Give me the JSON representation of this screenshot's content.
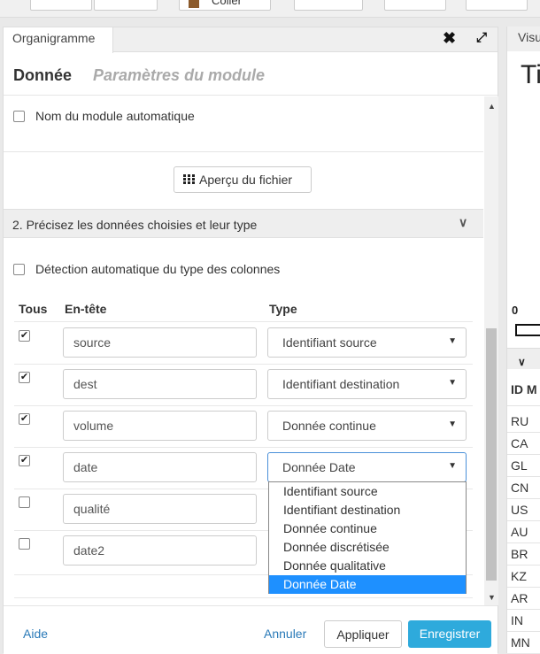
{
  "toolbar": {
    "paste_label": "Coller"
  },
  "panel": {
    "tab_label": "Organigramme",
    "close_glyph": "✖",
    "expand_glyph": "⤢",
    "header": {
      "title": "Donnée",
      "subtitle": "Paramètres du module"
    }
  },
  "form": {
    "auto_name_label": "Nom du module automatique",
    "apercu_label": "Aperçu du fichier",
    "section_title": "2. Précisez les données choisies et leur type",
    "auto_detect_label": "Détection automatique du type des colonnes",
    "columns": {
      "all": "Tous",
      "header": "En-tête",
      "type": "Type"
    },
    "rows": [
      {
        "checked": true,
        "header": "source",
        "type": "Identifiant source"
      },
      {
        "checked": true,
        "header": "dest",
        "type": "Identifiant destination"
      },
      {
        "checked": true,
        "header": "volume",
        "type": "Donnée continue"
      },
      {
        "checked": true,
        "header": "date",
        "type": "Donnée Date"
      },
      {
        "checked": false,
        "header": "qualité",
        "type": ""
      },
      {
        "checked": false,
        "header": "date2",
        "type": ""
      }
    ],
    "type_options": [
      "Identifiant source",
      "Identifiant destination",
      "Donnée continue",
      "Donnée discrétisée",
      "Donnée qualitative",
      "Donnée Date"
    ],
    "selected_option_index": 5
  },
  "footer": {
    "help": "Aide",
    "cancel": "Annuler",
    "apply": "Appliquer",
    "save": "Enregistrer"
  },
  "right_panel": {
    "tab_label": "Visu",
    "big_text": "Ti",
    "zero_label": "0",
    "table_header": "ID M",
    "codes": [
      "RU",
      "CA",
      "GL",
      "CN",
      "US",
      "AU",
      "BR",
      "KZ",
      "AR",
      "IN",
      "MN"
    ]
  },
  "colors": {
    "accent": "#1e90ff",
    "save_button": "#2eaadc",
    "link": "#2a7ab8"
  }
}
